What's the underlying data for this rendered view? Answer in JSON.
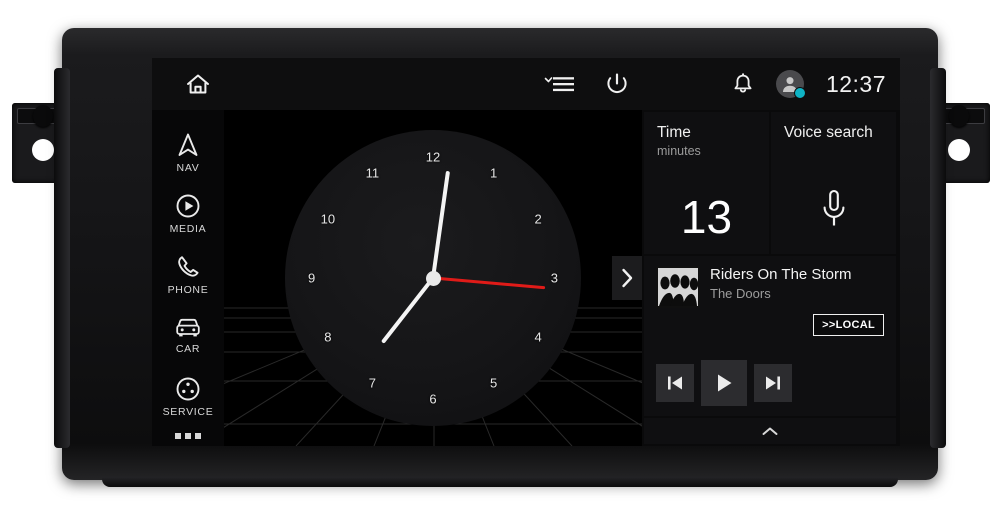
{
  "device": {
    "name": "car-head-unit",
    "bracket_left": "mounting-bracket-left",
    "bracket_right": "mounting-bracket-right"
  },
  "topbar": {
    "home_icon": "home-icon",
    "menu_icon": "hamburger-menu-icon",
    "power_icon": "power-icon",
    "bell_icon": "notification-bell-icon",
    "avatar_icon": "user-avatar-icon",
    "badge_color": "#0fb3c4",
    "time": "12:37"
  },
  "sidebar": {
    "items": [
      {
        "label": "NAV",
        "icon": "navigation-arrow-icon"
      },
      {
        "label": "MEDIA",
        "icon": "media-play-circle-icon"
      },
      {
        "label": "PHONE",
        "icon": "phone-handset-icon"
      },
      {
        "label": "CAR",
        "icon": "car-front-icon"
      },
      {
        "label": "SERVICE",
        "icon": "service-wheel-icon"
      }
    ],
    "more_label": "more-options-dots"
  },
  "clock": {
    "numerals": [
      "12",
      "1",
      "2",
      "3",
      "4",
      "5",
      "6",
      "7",
      "8",
      "9",
      "10",
      "11"
    ],
    "hour_angle": 218,
    "minute_angle": 8,
    "second_angle": 95,
    "second_hand_color": "#e01b18",
    "hand_color": "#f4f4f4"
  },
  "expand_tab": {
    "icon": "chevron-right-icon"
  },
  "widgets": {
    "time_tile": {
      "title": "Time",
      "subtitle": "minutes",
      "value": "13"
    },
    "voice_tile": {
      "title": "Voice search",
      "icon": "microphone-icon"
    },
    "media": {
      "track_title": "Riders On The Storm",
      "artist": "The Doors",
      "source_label": ">>LOCAL",
      "album_art": "album-art-the-doors",
      "controls": [
        {
          "name": "previous-track-button",
          "icon": "skip-previous-icon"
        },
        {
          "name": "play-button",
          "icon": "play-icon"
        },
        {
          "name": "next-track-button",
          "icon": "skip-next-icon"
        }
      ]
    },
    "collapse": {
      "icon": "chevron-up-icon"
    }
  }
}
